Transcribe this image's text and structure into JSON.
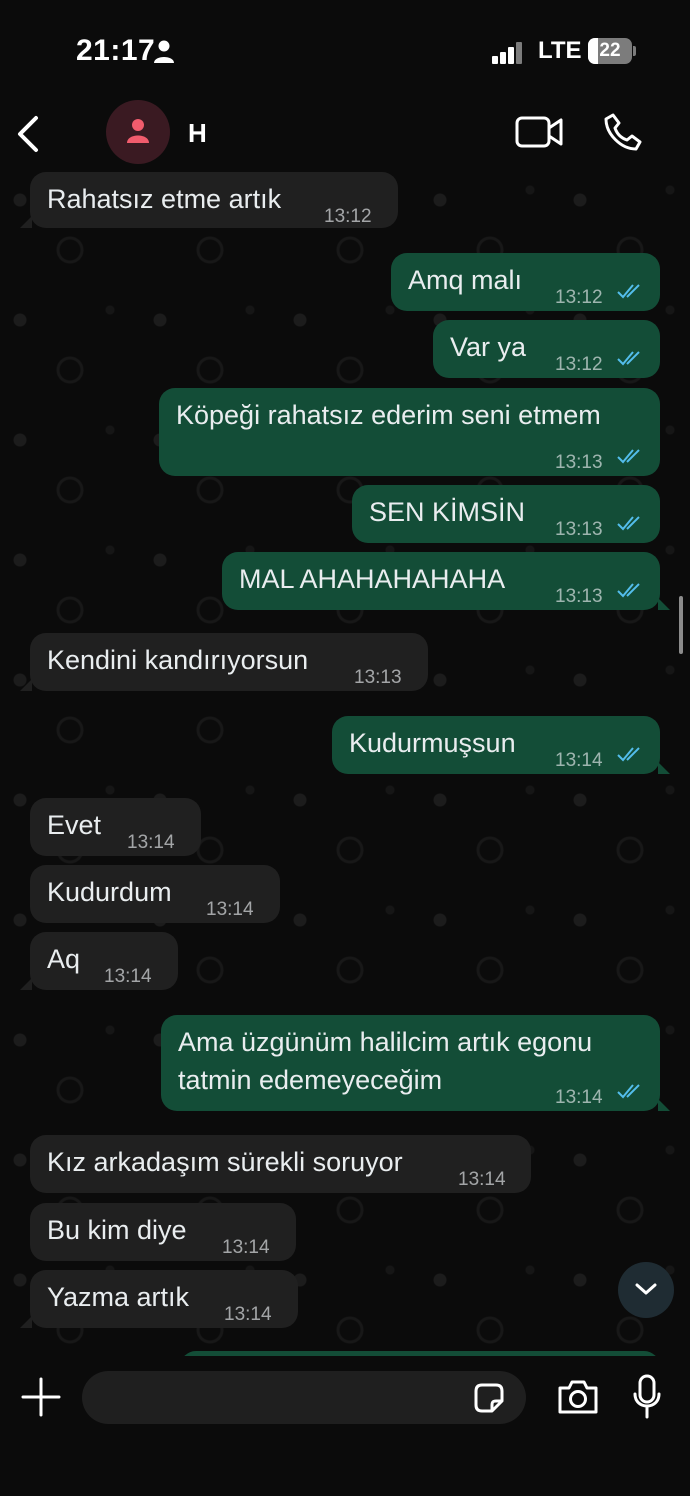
{
  "status_bar": {
    "time": "21:17",
    "network": "LTE",
    "battery": "22"
  },
  "header": {
    "contact_name": "H"
  },
  "messages": [
    {
      "text": "Rahatsız etme artık",
      "time": "13:12",
      "dir": "in"
    },
    {
      "text": "Amq malı",
      "time": "13:12",
      "dir": "out"
    },
    {
      "text": "Var ya",
      "time": "13:12",
      "dir": "out"
    },
    {
      "text": "Köpeği rahatsız ederim seni etmem",
      "time": "13:13",
      "dir": "out"
    },
    {
      "text": "SEN KİMSİN",
      "time": "13:13",
      "dir": "out"
    },
    {
      "text": "MAL AHAHAHAHAHA",
      "time": "13:13",
      "dir": "out"
    },
    {
      "text": "Kendini kandırıyorsun",
      "time": "13:13",
      "dir": "in"
    },
    {
      "text": "Kudurmuşsun",
      "time": "13:14",
      "dir": "out"
    },
    {
      "text": "Evet",
      "time": "13:14",
      "dir": "in"
    },
    {
      "text": "Kudurdum",
      "time": "13:14",
      "dir": "in"
    },
    {
      "text": "Aq",
      "time": "13:14",
      "dir": "in"
    },
    {
      "text": "Ama üzgünüm halilcim artık egonu",
      "text2": "tatmin edemeyeceğim",
      "time": "13:14",
      "dir": "out"
    },
    {
      "text": "Kız arkadaşım sürekli soruyor",
      "time": "13:14",
      "dir": "in"
    },
    {
      "text": "Bu kim diye",
      "time": "13:14",
      "dir": "in"
    },
    {
      "text": "Yazma artık",
      "time": "13:14",
      "dir": "in"
    }
  ],
  "composer": {
    "placeholder": ""
  },
  "colors": {
    "incoming": "#202020",
    "outgoing": "#134d37",
    "read_ticks": "#53bdeb"
  }
}
